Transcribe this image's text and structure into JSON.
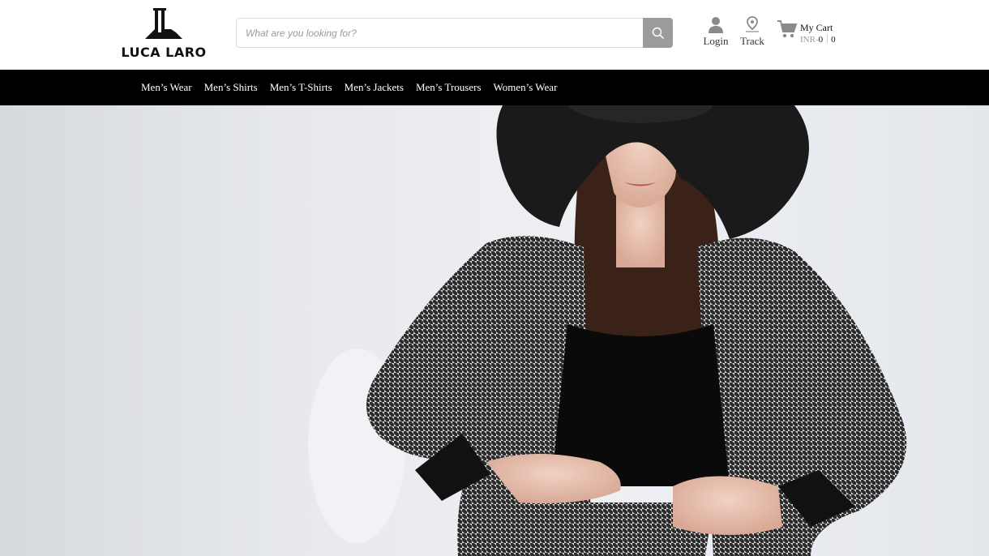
{
  "brand": {
    "name": "LUCA LARO"
  },
  "search": {
    "placeholder": "What are you looking for?",
    "icon": "search-icon"
  },
  "header": {
    "login_label": "Login",
    "track_label": "Track",
    "cart": {
      "title": "My Cart",
      "currency": "INR",
      "amount": "0",
      "count": "0"
    }
  },
  "nav": {
    "items": [
      {
        "label": "Men’s Wear"
      },
      {
        "label": "Men’s Shirts"
      },
      {
        "label": "Men’s T-Shirts"
      },
      {
        "label": "Men’s Jackets"
      },
      {
        "label": "Men’s Trousers"
      },
      {
        "label": "Women’s Wear"
      }
    ]
  },
  "colors": {
    "nav_bg": "#000000",
    "search_button": "#9b9b9b",
    "hero_bg": "#e7e9ee"
  }
}
